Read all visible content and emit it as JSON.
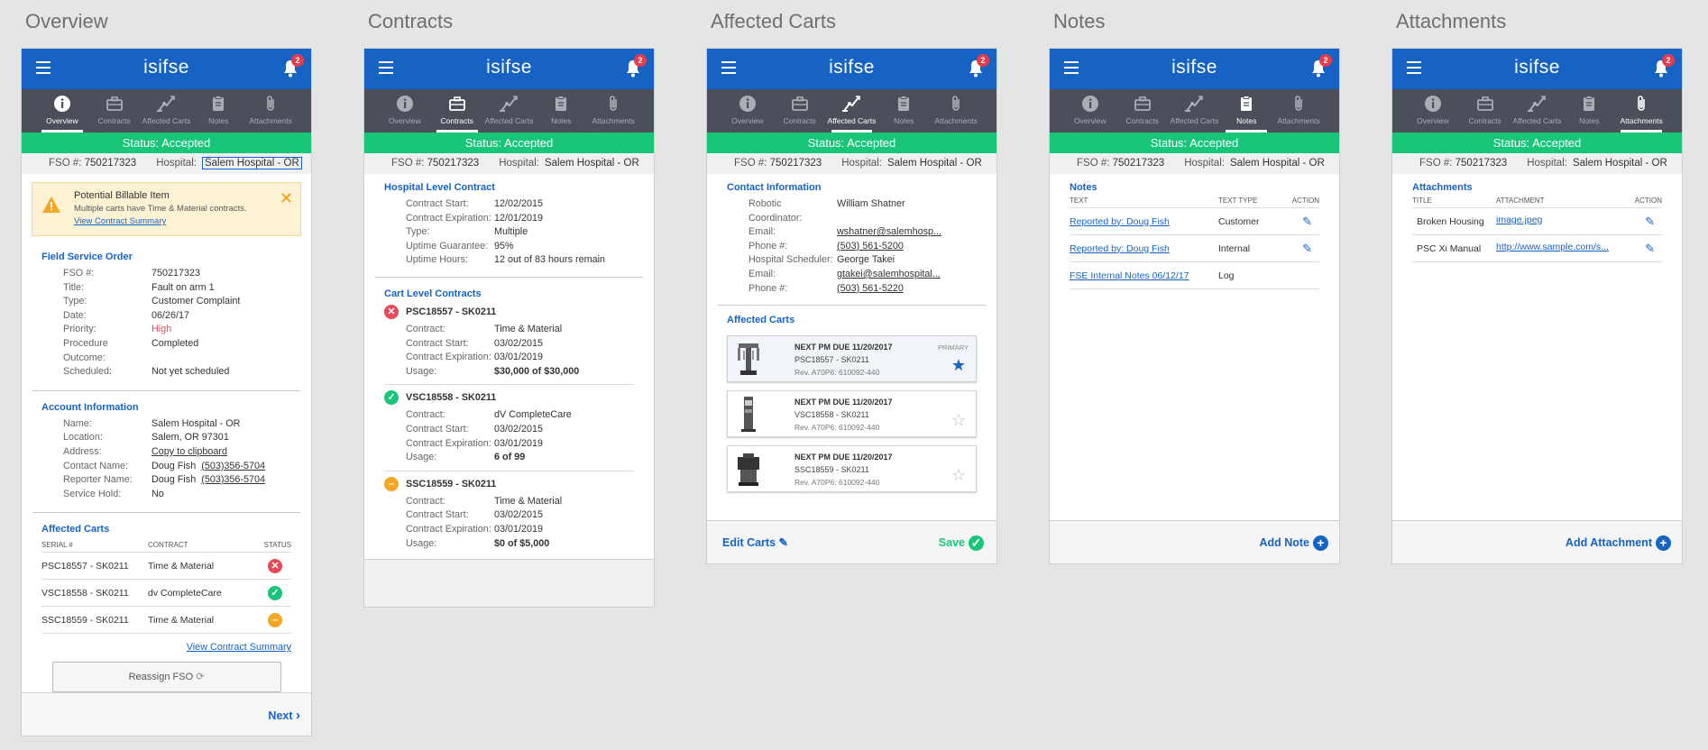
{
  "screens": {
    "overview": "Overview",
    "contracts": "Contracts",
    "carts": "Affected Carts",
    "notes": "Notes",
    "attachments": "Attachments"
  },
  "app": {
    "logo": "isifse",
    "notifications": "2",
    "tabs": [
      "Overview",
      "Contracts",
      "Affected Carts",
      "Notes",
      "Attachments"
    ],
    "status": "Status: Accepted",
    "fso_label": "FSO #:",
    "fso_value": "750217323",
    "hospital_label": "Hospital:",
    "hospital_value": "Salem Hospital - OR"
  },
  "overview": {
    "alert": {
      "title": "Potential Billable Item",
      "text": "Multiple carts have Time & Material contracts.",
      "link": "View Contract Summary"
    },
    "fso_section": {
      "title": "Field Service Order",
      "rows": [
        {
          "k": "FSO #:",
          "v": "750217323"
        },
        {
          "k": "Title:",
          "v": "Fault on arm 1"
        },
        {
          "k": "Type:",
          "v": "Customer Complaint"
        },
        {
          "k": "Date:",
          "v": "06/26/17"
        },
        {
          "k": "Priority:",
          "v": "High"
        },
        {
          "k": "Procedure Outcome:",
          "v": "Completed"
        },
        {
          "k": "Scheduled:",
          "v": "Not yet scheduled"
        }
      ]
    },
    "account": {
      "title": "Account Information",
      "name_k": "Name:",
      "name_v": "Salem Hospital - OR",
      "location_k": "Location:",
      "location_v": "Salem, OR 97301",
      "address_k": "Address:",
      "address_v": "Copy to clipboard",
      "contact_k": "Contact Name:",
      "contact_v": "Doug Fish",
      "contact_phone": "(503)356-5704",
      "reporter_k": "Reporter Name:",
      "reporter_v": "Doug Fish",
      "reporter_phone": "(503)356-5704",
      "hold_k": "Service Hold:",
      "hold_v": "No"
    },
    "carts": {
      "title": "Affected Carts",
      "headers": [
        "SERIAL #",
        "CONTRACT",
        "STATUS"
      ],
      "rows": [
        {
          "serial": "PSC18557 - SK0211",
          "contract": "Time & Material",
          "status": "red"
        },
        {
          "serial": "VSC18558 - SK0211",
          "contract": "dv CompleteCare",
          "status": "green"
        },
        {
          "serial": "SSC18559 - SK0211",
          "contract": "Time & Material",
          "status": "orange"
        }
      ],
      "link": "View Contract Summary"
    },
    "reassign": "Reassign FSO",
    "next": "Next"
  },
  "contracts": {
    "hospital_title": "Hospital Level Contract",
    "hospital_rows": [
      {
        "k": "Contract Start:",
        "v": "12/02/2015"
      },
      {
        "k": "Contract Expiration:",
        "v": "12/01/2019"
      },
      {
        "k": "Type:",
        "v": "Multiple"
      },
      {
        "k": "Uptime Guarantee:",
        "v": "95%"
      },
      {
        "k": "Uptime Hours:",
        "v": "12 out of 83 hours remain"
      }
    ],
    "cart_title": "Cart Level Contracts",
    "carts": [
      {
        "name": "PSC18557 - SK0211",
        "status": "red",
        "rows": [
          {
            "k": "Contract:",
            "v": "Time & Material"
          },
          {
            "k": "Contract Start:",
            "v": "03/02/2015"
          },
          {
            "k": "Contract Expiration:",
            "v": "03/01/2019"
          },
          {
            "k": "Usage:",
            "v": "$30,000 of $30,000"
          }
        ]
      },
      {
        "name": "VSC18558 - SK0211",
        "status": "green",
        "rows": [
          {
            "k": "Contract:",
            "v": "dV CompleteCare"
          },
          {
            "k": "Contract Start:",
            "v": "03/02/2015"
          },
          {
            "k": "Contract Expiration:",
            "v": "03/01/2019"
          },
          {
            "k": "Usage:",
            "v": "6 of 99"
          }
        ]
      },
      {
        "name": "SSC18559 - SK0211",
        "status": "orange",
        "rows": [
          {
            "k": "Contract:",
            "v": "Time & Material"
          },
          {
            "k": "Contract Start:",
            "v": "03/02/2015"
          },
          {
            "k": "Contract Expiration:",
            "v": "03/01/2019"
          },
          {
            "k": "Usage:",
            "v": "$0 of $5,000"
          }
        ]
      }
    ]
  },
  "affected": {
    "contact_title": "Contact Information",
    "contact_rows": [
      {
        "k": "Robotic Coordinator:",
        "v": "William Shatner",
        "link": false
      },
      {
        "k": "Email:",
        "v": "wshatner@salemhosp...",
        "link": true
      },
      {
        "k": "Phone #:",
        "v": "(503) 561-5200",
        "link": true
      },
      {
        "k": "Hospital Scheduler:",
        "v": "George Takei",
        "link": false
      },
      {
        "k": "Email:",
        "v": "gtakei@salemhospital...",
        "link": true
      },
      {
        "k": "Phone #:",
        "v": "(503) 561-5220",
        "link": true
      }
    ],
    "carts_title": "Affected Carts",
    "carts": [
      {
        "due": "NEXT PM DUE 11/20/2017",
        "serial": "PSC18557 - SK0211",
        "rev": "Rev. A70P6: 610092-440",
        "primary": "PRIMARY"
      },
      {
        "due": "NEXT PM DUE 11/20/2017",
        "serial": "VSC18558 - SK0211",
        "rev": "Rev. A70P6: 610092-440"
      },
      {
        "due": "NEXT PM DUE 11/20/2017",
        "serial": "SSC18559 - SK0211",
        "rev": "Rev. A70P6: 610092-440"
      }
    ],
    "edit": "Edit Carts",
    "save": "Save"
  },
  "notes": {
    "title": "Notes",
    "headers": [
      "TEXT",
      "TEXT TYPE",
      "ACTION"
    ],
    "rows": [
      {
        "text": "Reported by: Doug Fish",
        "type": "Customer",
        "edit": true
      },
      {
        "text": "Reported by: Doug Fish",
        "type": "Internal",
        "edit": true
      },
      {
        "text": "FSE Internal Notes 06/12/17",
        "type": "Log",
        "edit": false
      }
    ],
    "add": "Add Note"
  },
  "attachments": {
    "title": "Attachments",
    "headers": [
      "TITLE",
      "ATTACHMENT",
      "ACTION"
    ],
    "rows": [
      {
        "title": "Broken Housing",
        "file": "image.jpeg"
      },
      {
        "title": "PSC Xi Manual",
        "file": "http://www.sample.com/s..."
      }
    ],
    "add": "Add Attachment"
  },
  "colors": {
    "brand": "#1763c4",
    "tabbar": "#4b4f59",
    "status": "#18c579",
    "high": "#e84a5a",
    "warning": "#f5a623"
  }
}
